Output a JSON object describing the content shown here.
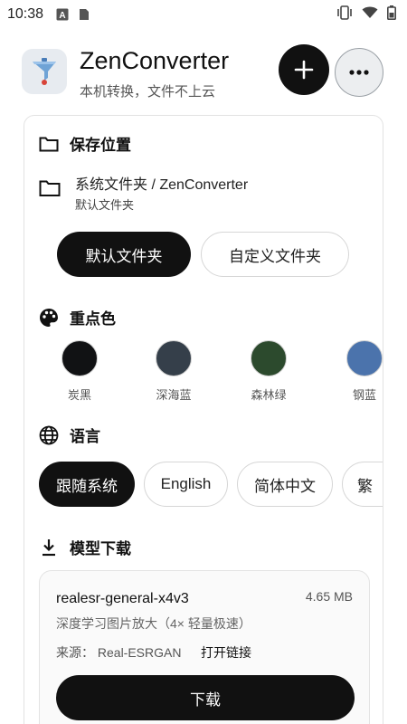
{
  "status_bar": {
    "time": "10:38",
    "icons": [
      "a-badge-icon",
      "file-icon",
      "vibrate-icon",
      "wifi-icon",
      "battery-icon"
    ]
  },
  "header": {
    "title": "ZenConverter",
    "subtitle": "本机转换，文件不上云",
    "add_icon": "plus-icon",
    "more_icon": "more-horizontal-icon"
  },
  "save_location": {
    "title": "保存位置",
    "path": "系统文件夹 / ZenConverter",
    "path_sub": "默认文件夹",
    "default_button": "默认文件夹",
    "custom_button": "自定义文件夹"
  },
  "accent": {
    "title": "重点色",
    "swatches": [
      {
        "label": "炭黑",
        "color": "#111214"
      },
      {
        "label": "深海蓝",
        "color": "#353f4a"
      },
      {
        "label": "森林绿",
        "color": "#2c4a2d"
      },
      {
        "label": "钢蓝",
        "color": "#4b73ac"
      }
    ]
  },
  "language": {
    "title": "语言",
    "options": [
      "跟随系统",
      "English",
      "简体中文",
      "繁"
    ]
  },
  "models": {
    "title": "模型下载",
    "items": [
      {
        "name": "realesr-general-x4v3",
        "size": "4.65 MB",
        "description": "深度学习图片放大（4× 轻量极速）",
        "source": "来源： Real-ESRGAN",
        "link": "打开链接",
        "button": "下载"
      }
    ]
  },
  "colors": {
    "primary": "#111111",
    "background": "#ffffff",
    "border": "#e3e3e3"
  }
}
